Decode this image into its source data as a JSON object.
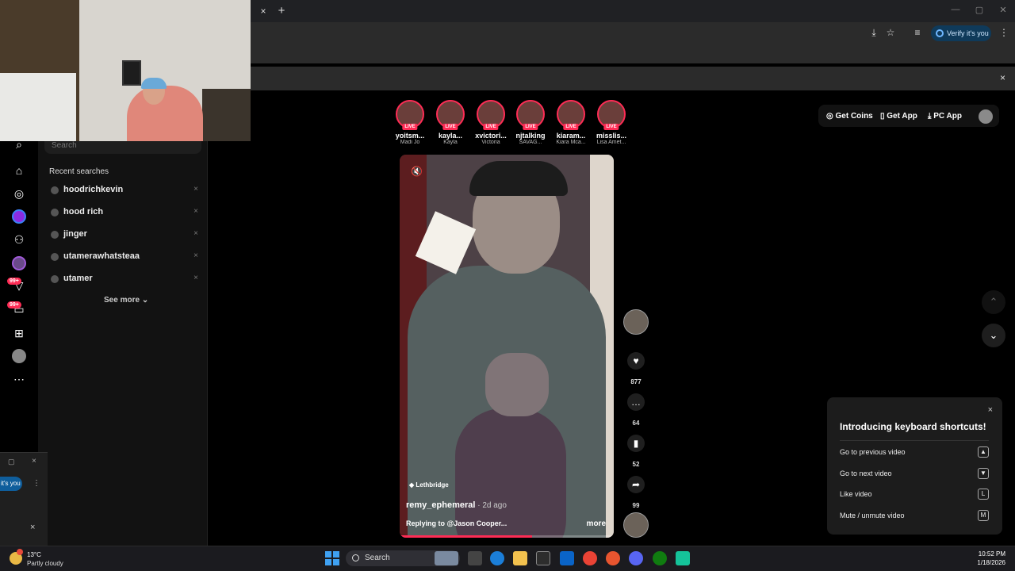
{
  "browser": {
    "tab_close": "×",
    "new_tab": "+",
    "verify_label": "Verify it's you",
    "infobar_close": "×"
  },
  "sidebar": {
    "search_placeholder": "Search",
    "badges": [
      "99+",
      "99+"
    ]
  },
  "recent": {
    "title": "Recent searches",
    "items": [
      "hoodrichkevin",
      "hood rich",
      "jinger",
      "utamerawhatsteaa",
      "utamer"
    ],
    "remove": "×",
    "see_more": "See more"
  },
  "mini_popup": {
    "pill": "it's you",
    "close": "×"
  },
  "stories": [
    {
      "name": "yoitsm...",
      "sub": "Madi Jo",
      "live": "LIVE"
    },
    {
      "name": "kayla...",
      "sub": "Kayla",
      "live": "LIVE"
    },
    {
      "name": "xvictori...",
      "sub": "Victoria",
      "live": "LIVE"
    },
    {
      "name": "njtalking",
      "sub": "SAVAG...",
      "live": "LIVE"
    },
    {
      "name": "kiaram...",
      "sub": "Kiara Mca...",
      "live": "LIVE"
    },
    {
      "name": "misslis...",
      "sub": "Lisa Amet...",
      "live": "LIVE"
    }
  ],
  "topbar": {
    "get_coins": "Get Coins",
    "get_app": "Get App",
    "pc_app": "PC App"
  },
  "video": {
    "location": "Lethbridge",
    "username": "remy_ephemeral",
    "ago": " · 2d ago",
    "caption": "Replying to @Jason Cooper...",
    "more": "more",
    "progress": 0.62
  },
  "actions": {
    "likes": "877",
    "comments": "64",
    "saves": "52",
    "shares": "99"
  },
  "shortcuts": {
    "title": "Introducing keyboard shortcuts!",
    "close": "×",
    "rows": [
      {
        "label": "Go to previous video",
        "key": "▲"
      },
      {
        "label": "Go to next video",
        "key": "▼"
      },
      {
        "label": "Like video",
        "key": "L"
      },
      {
        "label": "Mute / unmute video",
        "key": "M"
      }
    ]
  },
  "taskbar": {
    "temp": "13°C",
    "condition": "Partly cloudy",
    "search": "Search",
    "time": "10:52 PM",
    "date": "1/18/2026"
  },
  "colors": {
    "accent": "#fe2c55",
    "background": "#000000",
    "panel": "#121212"
  },
  "icons": [
    "close-icon",
    "plus-icon",
    "star-icon",
    "search-icon",
    "home-icon",
    "compass-icon",
    "users-icon",
    "upload-icon",
    "more-icon",
    "heart-icon",
    "comment-icon",
    "bookmark-icon",
    "share-icon",
    "chevron-up-icon",
    "chevron-down-icon",
    "mute-icon",
    "windows-logo-icon"
  ]
}
